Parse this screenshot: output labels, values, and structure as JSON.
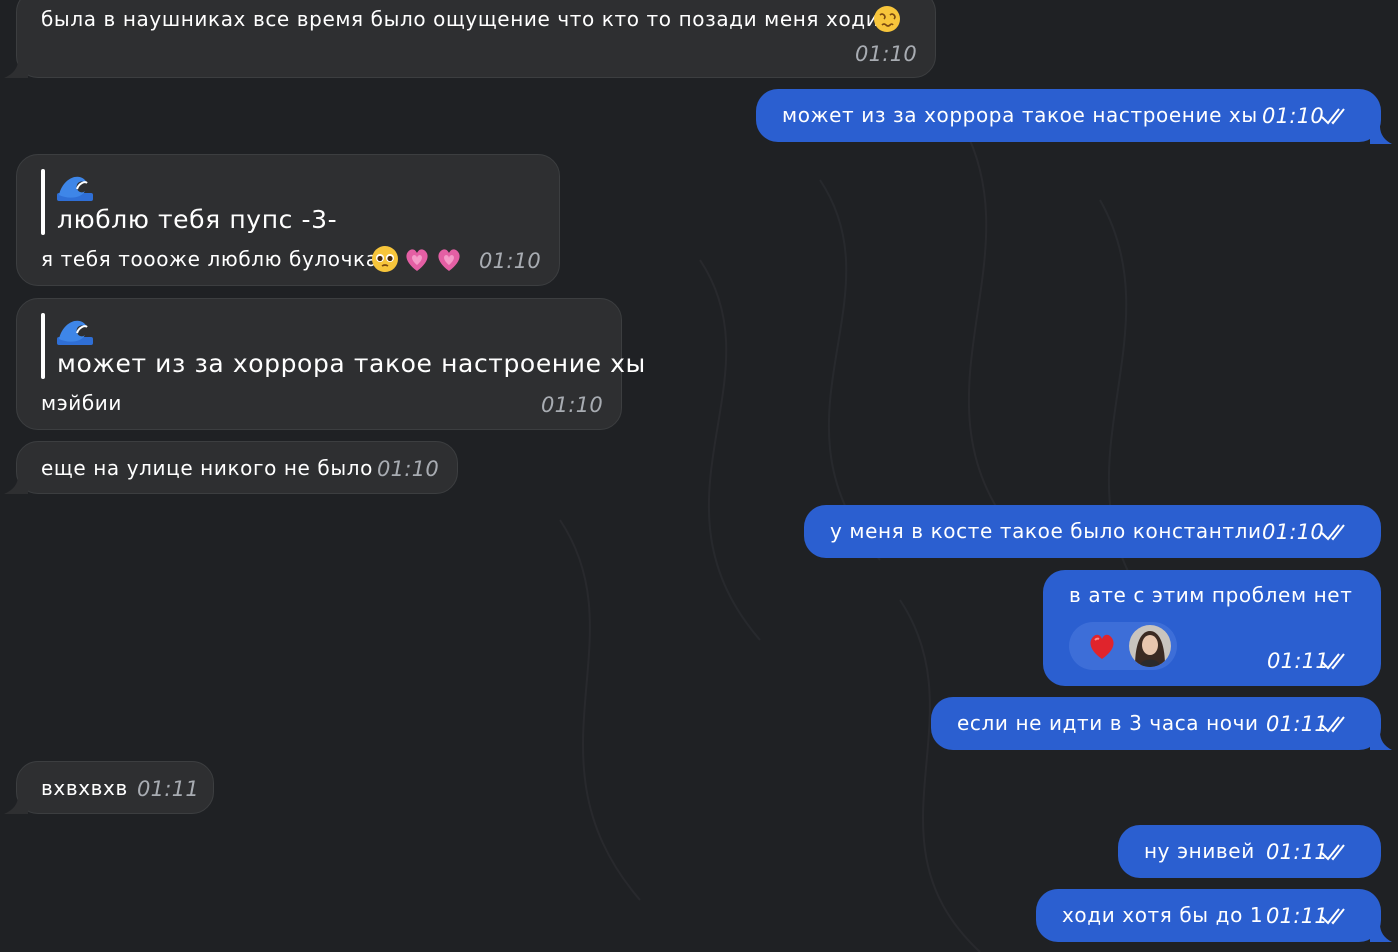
{
  "messages": [
    {
      "id": "m1",
      "side": "in",
      "text": "была в наушниках все время было ощущение что кто то позади меня ходит",
      "emoji": "dizzy-face-emoji",
      "time": "01:10"
    },
    {
      "id": "m2",
      "side": "out",
      "text": "может из за хоррора такое настроение хы",
      "time": "01:10",
      "status": "read"
    },
    {
      "id": "m3",
      "side": "in",
      "quote_emoji": "wave-emoji",
      "quote_text": "люблю тебя пупс -3-",
      "text": "я тебя тоооже люблю булочка",
      "emojis": [
        "pleading-face-emoji",
        "growing-heart-emoji",
        "growing-heart-emoji"
      ],
      "time": "01:10"
    },
    {
      "id": "m4",
      "side": "in",
      "quote_emoji": "wave-emoji",
      "quote_text": "может из за хоррора такое настроение хы",
      "text": "мэйбии",
      "time": "01:10"
    },
    {
      "id": "m5",
      "side": "in",
      "text": "еще на улице никого не было",
      "time": "01:10"
    },
    {
      "id": "m6",
      "side": "out",
      "text": "у меня в косте такое было константли",
      "time": "01:10",
      "status": "read"
    },
    {
      "id": "m7",
      "side": "out",
      "text": "в ате с этим проблем нет",
      "reaction": "red-heart-emoji",
      "time": "01:11",
      "status": "read"
    },
    {
      "id": "m8",
      "side": "out",
      "text": "если не идти в 3 часа ночи",
      "time": "01:11",
      "status": "read"
    },
    {
      "id": "m9",
      "side": "in",
      "text": "вхвхвхв",
      "time": "01:11"
    },
    {
      "id": "m10",
      "side": "out",
      "text": "ну энивей",
      "time": "01:11",
      "status": "read"
    },
    {
      "id": "m11",
      "side": "out",
      "text": "ходи хотя бы до 1",
      "time": "01:11",
      "status": "read"
    }
  ],
  "colors": {
    "background": "#1f2124",
    "incoming": "#2e2f31",
    "outgoing": "#2b5fd0",
    "reaction": "#3d6ed8",
    "time_incoming": "#a8acb2"
  }
}
